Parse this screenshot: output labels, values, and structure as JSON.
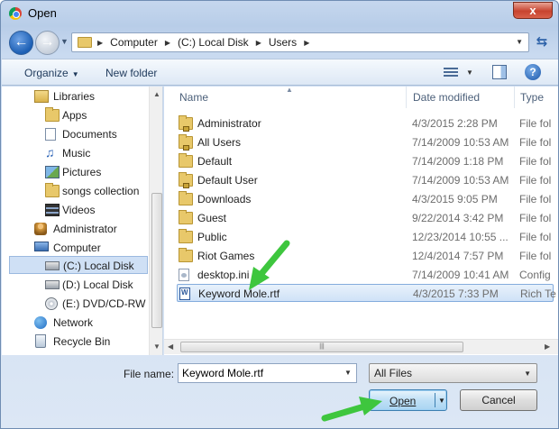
{
  "window": {
    "title": "Open",
    "close_label": "x"
  },
  "address": {
    "crumbs": [
      "Computer",
      "(C:) Local Disk",
      "Users"
    ]
  },
  "toolbar": {
    "organize_label": "Organize",
    "new_folder_label": "New folder"
  },
  "navigation": {
    "items": [
      {
        "label": "Libraries",
        "icon": "libraries-icon"
      },
      {
        "label": "Apps",
        "icon": "folder-icon"
      },
      {
        "label": "Documents",
        "icon": "documents-icon"
      },
      {
        "label": "Music",
        "icon": "music-icon"
      },
      {
        "label": "Pictures",
        "icon": "pictures-icon"
      },
      {
        "label": "songs collection",
        "icon": "folder-icon"
      },
      {
        "label": "Videos",
        "icon": "videos-icon"
      },
      {
        "label": "Administrator",
        "icon": "user-folder-icon"
      },
      {
        "label": "Computer",
        "icon": "computer-icon"
      },
      {
        "label": "(C:) Local Disk",
        "icon": "drive-icon",
        "selected": true
      },
      {
        "label": "(D:) Local Disk",
        "icon": "drive-icon"
      },
      {
        "label": "(E:) DVD/CD-RW D",
        "icon": "dvd-icon"
      },
      {
        "label": "Network",
        "icon": "network-icon"
      },
      {
        "label": "Recycle Bin",
        "icon": "recycle-bin-icon"
      }
    ]
  },
  "filelist": {
    "columns": {
      "name": "Name",
      "date": "Date modified",
      "type": "Type"
    },
    "rows": [
      {
        "name": "Administrator",
        "date": "4/3/2015 2:28 PM",
        "type": "File fol",
        "icon": "locked-folder-icon"
      },
      {
        "name": "All Users",
        "date": "7/14/2009 10:53 AM",
        "type": "File fol",
        "icon": "locked-folder-icon"
      },
      {
        "name": "Default",
        "date": "7/14/2009 1:18 PM",
        "type": "File fol",
        "icon": "folder-icon"
      },
      {
        "name": "Default User",
        "date": "7/14/2009 10:53 AM",
        "type": "File fol",
        "icon": "locked-folder-icon"
      },
      {
        "name": "Downloads",
        "date": "4/3/2015 9:05 PM",
        "type": "File fol",
        "icon": "folder-icon"
      },
      {
        "name": "Guest",
        "date": "9/22/2014 3:42 PM",
        "type": "File fol",
        "icon": "folder-icon"
      },
      {
        "name": "Public",
        "date": "12/23/2014 10:55 ...",
        "type": "File fol",
        "icon": "folder-icon"
      },
      {
        "name": "Riot Games",
        "date": "12/4/2014 7:57 PM",
        "type": "File fol",
        "icon": "folder-icon"
      },
      {
        "name": "desktop.ini",
        "date": "7/14/2009 10:41 AM",
        "type": "Config",
        "icon": "settings-file-icon"
      },
      {
        "name": "Keyword Mole.rtf",
        "date": "4/3/2015 7:33 PM",
        "type": "Rich Te",
        "icon": "rtf-file-icon",
        "selected": true
      }
    ]
  },
  "bottom": {
    "file_name_label": "File name:",
    "file_name_value": "Keyword Mole.rtf",
    "file_type_value": "All Files",
    "open_label": "Open",
    "cancel_label": "Cancel"
  },
  "colors": {
    "selection": "#cfe0f5",
    "annotation_arrow": "#3ec63e"
  }
}
